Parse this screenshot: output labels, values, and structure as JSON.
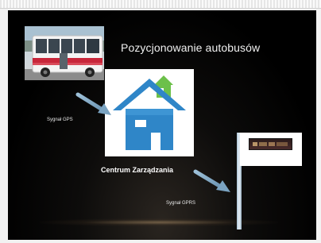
{
  "slide": {
    "title": "Pozycjonowanie autobusów",
    "center_label": "Centrum Zarządzania",
    "gps_label": "Sygnał GPS",
    "gprs_label": "Sygnał GPRS"
  },
  "icons": {
    "bus": "bus-photo",
    "house": "house-icon",
    "sign": "bus-stop-display-sign"
  },
  "colors": {
    "background": "#000000",
    "arrow": "#8ab0cc",
    "house_blue": "#2f86c8",
    "house_green": "#6cc04a",
    "text": "#ffffff"
  }
}
